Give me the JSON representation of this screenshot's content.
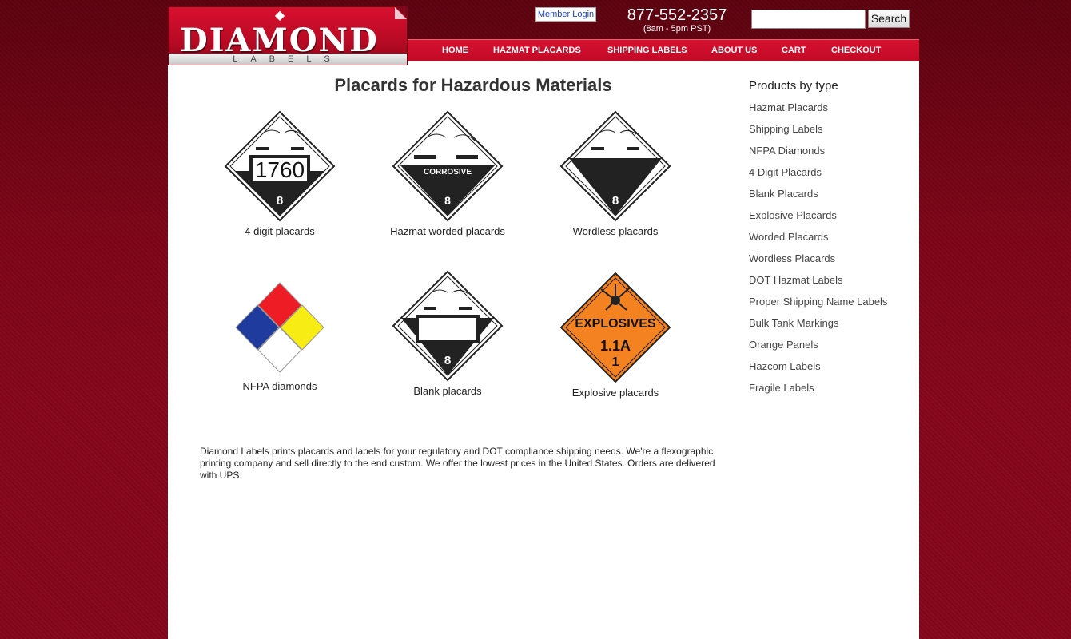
{
  "logo": {
    "text": "DIAMOND",
    "subtext": "LABELS"
  },
  "header": {
    "member_login": "Member Login",
    "phone": "877-552-2357",
    "hours": "(8am - 5pm PST)",
    "search_value": "",
    "search_button": "Search"
  },
  "nav": [
    "HOME",
    "HAZMAT PLACARDS",
    "SHIPPING LABELS",
    "ABOUT US",
    "CART",
    "CHECKOUT"
  ],
  "main": {
    "title": "Placards for Hazardous Materials",
    "tiles": [
      {
        "caption": "4 digit placards",
        "number": "1760",
        "class_num": "8"
      },
      {
        "caption": "Hazmat worded placards",
        "word": "CORROSIVE",
        "class_num": "8"
      },
      {
        "caption": "Wordless placards",
        "class_num": "8"
      },
      {
        "caption": "NFPA diamonds"
      },
      {
        "caption": "Blank placards",
        "class_num": "8"
      },
      {
        "caption": "Explosive placards",
        "word": "EXPLOSIVES",
        "division": "1.1A",
        "class_num": "1"
      }
    ],
    "intro": "Diamond Labels prints placards and labels for your regulatory and DOT compliance shipping needs. We're a flexographic printing company and sell directly to the end custom. We offer the lowest prices in the United States. Orders are delivered with UPS."
  },
  "sidebar": {
    "heading": "Products by type",
    "items": [
      "Hazmat Placards",
      "Shipping Labels",
      "NFPA Diamonds",
      "4 Digit Placards",
      "Blank Placards",
      "Explosive Placards",
      "Worded Placards",
      "Wordless Placards",
      "DOT Hazmat Labels",
      "Proper Shipping Name Labels",
      "Bulk Tank Markings",
      "Orange Panels",
      "Hazcom Labels",
      "Fragile Labels"
    ]
  },
  "colors": {
    "brand_red": "#c30a27",
    "background": "#800a1c",
    "nfpa_red": "#ee1c25",
    "nfpa_blue": "#1f3b9e",
    "nfpa_yellow": "#f7ec13",
    "explosive_orange": "#f58220"
  }
}
